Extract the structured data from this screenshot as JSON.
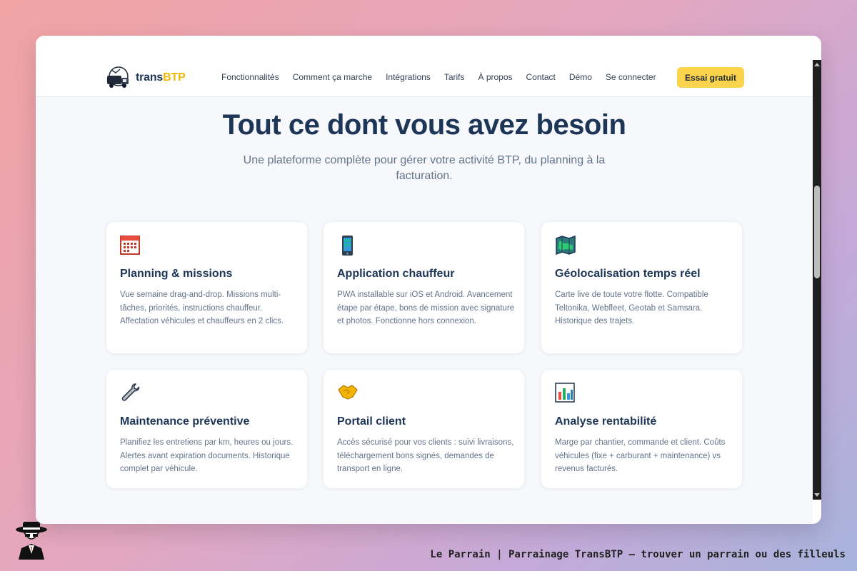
{
  "brand": {
    "name_prefix": "trans",
    "name_accent": "BTP"
  },
  "nav": {
    "links": [
      "Fonctionnalités",
      "Comment ça marche",
      "Intégrations",
      "Tarifs",
      "À propos",
      "Contact",
      "Démo",
      "Se connecter"
    ],
    "cta": "Essai gratuit"
  },
  "hero": {
    "title": "Tout ce dont vous avez besoin",
    "subtitle": "Une plateforme complète pour gérer votre activité BTP, du planning à la facturation."
  },
  "features": [
    {
      "icon": "calendar-icon",
      "title": "Planning & missions",
      "desc": "Vue semaine drag-and-drop. Missions multi-tâches, priorités, instructions chauffeur. Affectation véhicules et chauffeurs en 2 clics."
    },
    {
      "icon": "mobile-phone-icon",
      "title": "Application chauffeur",
      "desc": "PWA installable sur iOS et Android. Avancement étape par étape, bons de mission avec signature et photos. Fonctionne hors connexion."
    },
    {
      "icon": "map-icon",
      "title": "Géolocalisation temps réel",
      "desc": "Carte live de toute votre flotte. Compatible Teltonika, Webfleet, Geotab et Samsara. Historique des trajets."
    },
    {
      "icon": "wrench-icon",
      "title": "Maintenance préventive",
      "desc": "Planifiez les entretiens par km, heures ou jours. Alertes avant expiration documents. Historique complet par véhicule."
    },
    {
      "icon": "handshake-icon",
      "title": "Portail client",
      "desc": "Accès sécurisé pour vos clients : suivi livraisons, téléchargement bons signés, demandes de transport en ligne."
    },
    {
      "icon": "bar-chart-icon",
      "title": "Analyse rentabilité",
      "desc": "Marge par chantier, commande et client. Coûts véhicules (fixe + carburant + maintenance) vs revenus facturés."
    }
  ],
  "caption": "Le Parrain | Parrainage TransBTP — trouver un parrain ou des filleuls",
  "colors": {
    "brand_navy": "#1d3557",
    "accent_yellow": "#fcd34d",
    "muted_text": "#64748b"
  }
}
